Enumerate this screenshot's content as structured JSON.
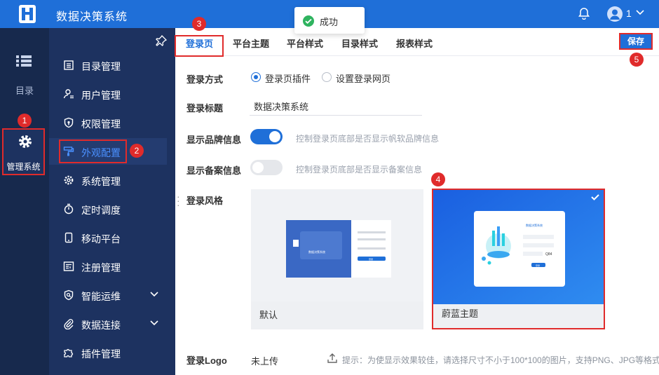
{
  "app": {
    "title": "数据决策系统"
  },
  "toast": {
    "text": "成功"
  },
  "user": {
    "name": "1"
  },
  "rail": {
    "directory_label": "目录",
    "admin_label": "管理系统"
  },
  "menu": {
    "items": [
      {
        "label": "目录管理",
        "icon": "catalog-icon"
      },
      {
        "label": "用户管理",
        "icon": "user-icon"
      },
      {
        "label": "权限管理",
        "icon": "shield-icon"
      },
      {
        "label": "外观配置",
        "icon": "paint-roller-icon",
        "active": true
      },
      {
        "label": "系统管理",
        "icon": "gear-icon"
      },
      {
        "label": "定时调度",
        "icon": "stopwatch-icon"
      },
      {
        "label": "移动平台",
        "icon": "mobile-icon"
      },
      {
        "label": "注册管理",
        "icon": "register-icon"
      },
      {
        "label": "智能运维",
        "icon": "shield-search-icon",
        "expandable": true
      },
      {
        "label": "数据连接",
        "icon": "paperclip-icon",
        "expandable": true
      },
      {
        "label": "插件管理",
        "icon": "puzzle-icon"
      }
    ]
  },
  "tabs": [
    {
      "label": "登录页",
      "active": true
    },
    {
      "label": "平台主题"
    },
    {
      "label": "平台样式"
    },
    {
      "label": "目录样式"
    },
    {
      "label": "报表样式"
    }
  ],
  "toolbar": {
    "save_label": "保存"
  },
  "form": {
    "login_mode": {
      "label": "登录方式",
      "options": [
        "登录页插件",
        "设置登录网页"
      ],
      "selected": "登录页插件"
    },
    "login_title": {
      "label": "登录标题",
      "value": "数据决策系统"
    },
    "show_brand": {
      "label": "显示品牌信息",
      "on": true,
      "hint": "控制登录页底部是否显示帆软品牌信息"
    },
    "show_record": {
      "label": "显示备案信息",
      "on": false,
      "hint": "控制登录页底部是否显示备案信息"
    },
    "login_style": {
      "label": "登录风格",
      "cards": [
        {
          "label": "默认",
          "selected": false,
          "preview_title": "数据决策系统",
          "preview_button": "登录"
        },
        {
          "label": "蔚蓝主题",
          "selected": true,
          "preview_title": "数据决策系统",
          "preview_captcha": "Q84",
          "preview_button": "登录"
        }
      ]
    },
    "login_logo": {
      "label": "登录Logo",
      "state": "未上传",
      "hint": "提示：为使显示效果较佳，请选择尺寸不小于100*100的图片，支持PNG、JPG等格式"
    }
  },
  "annotations": [
    "1",
    "2",
    "3",
    "4",
    "5"
  ],
  "colors": {
    "primary": "#1f6fd8",
    "sidebar_dark": "#17294d",
    "sidebar": "#1d3260",
    "highlight": "#e02b2b",
    "success": "#2fb35f"
  }
}
